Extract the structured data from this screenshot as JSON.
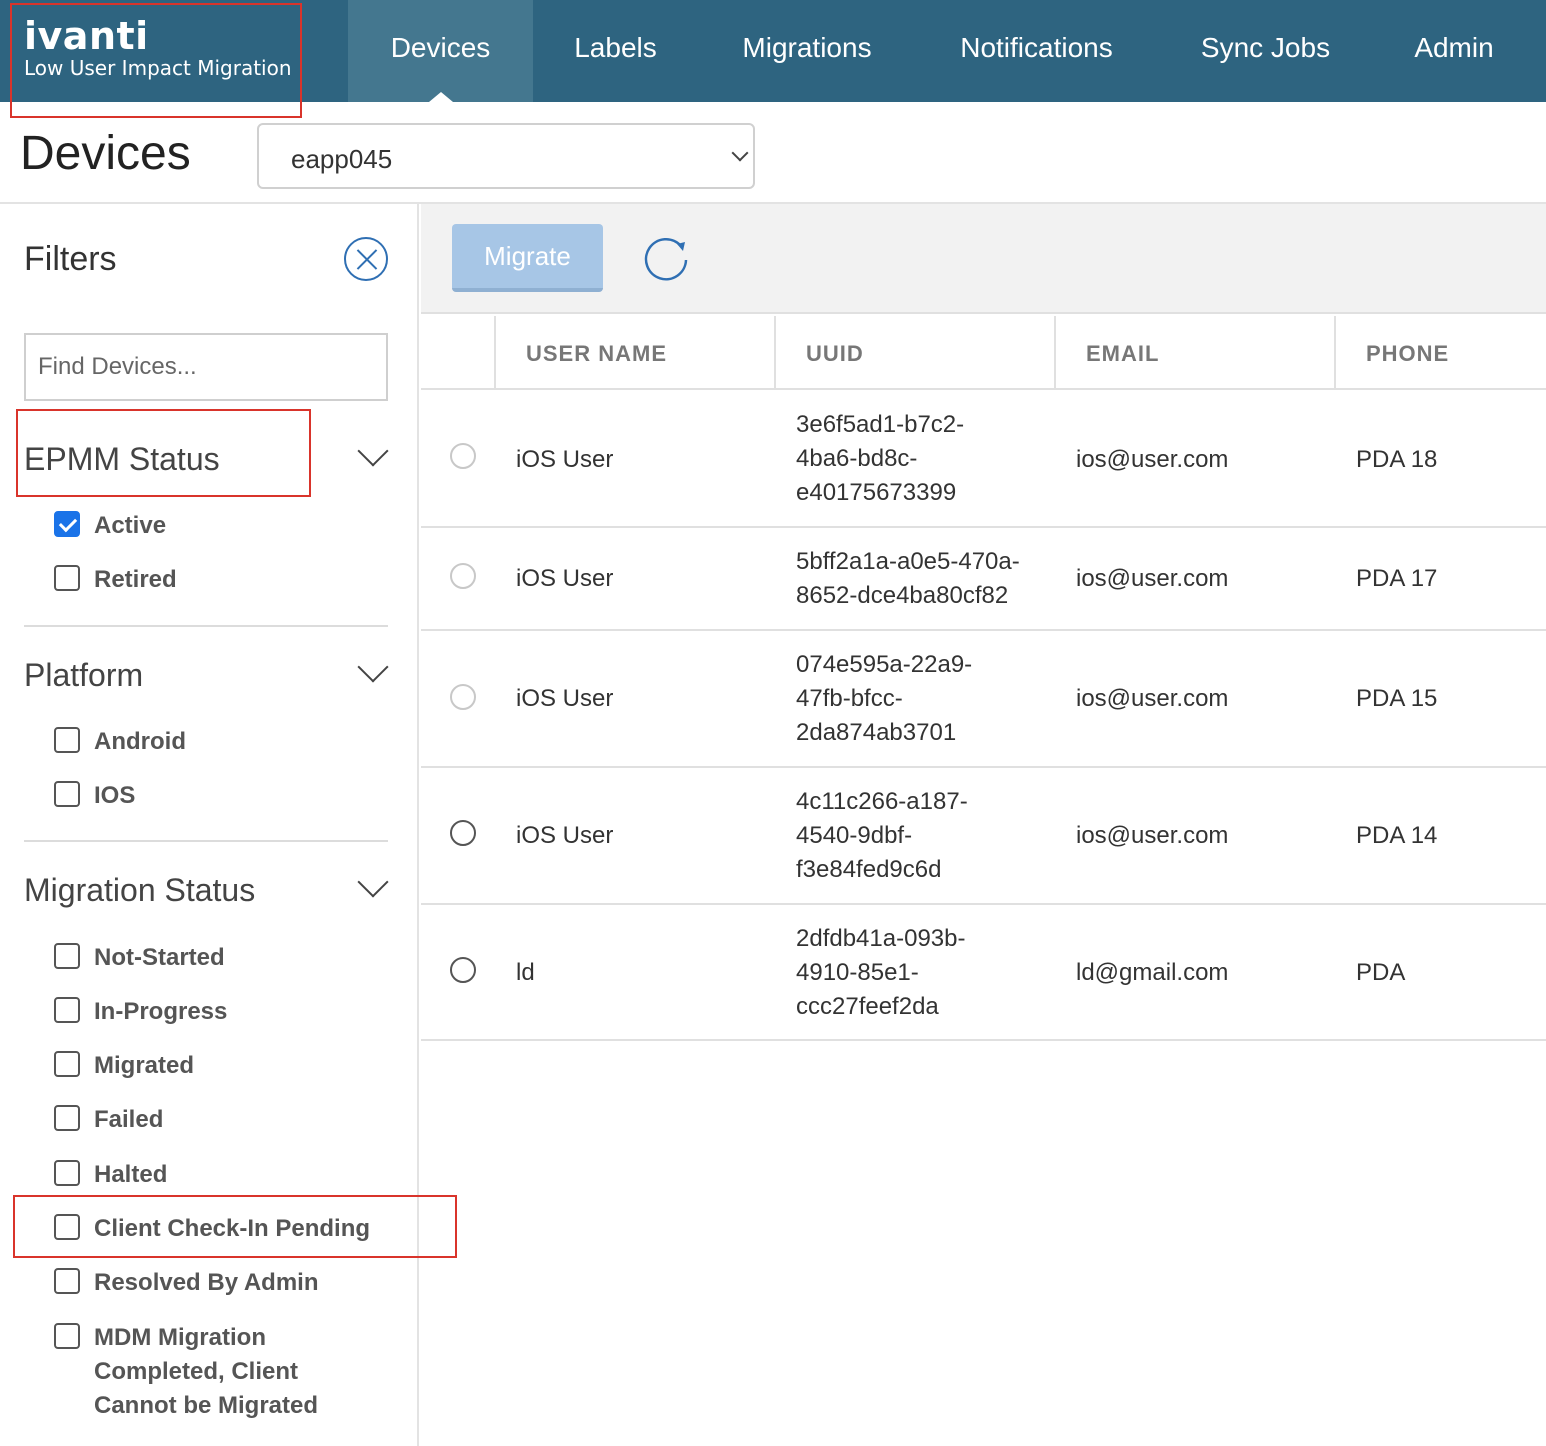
{
  "brand": {
    "logo": "ivanti",
    "subtitle": "Low User Impact Migration"
  },
  "nav": {
    "items": [
      {
        "label": "Devices",
        "active": true
      },
      {
        "label": "Labels",
        "active": false
      },
      {
        "label": "Migrations",
        "active": false
      },
      {
        "label": "Notifications",
        "active": false
      },
      {
        "label": "Sync Jobs",
        "active": false
      },
      {
        "label": "Admin",
        "active": false
      }
    ]
  },
  "page": {
    "title": "Devices",
    "tenant_select": "eapp045"
  },
  "filters": {
    "title": "Filters",
    "search_placeholder": "Find Devices...",
    "sections": [
      {
        "title": "EPMM Status",
        "options": [
          {
            "label": "Active",
            "checked": true
          },
          {
            "label": "Retired",
            "checked": false
          }
        ]
      },
      {
        "title": "Platform",
        "options": [
          {
            "label": "Android",
            "checked": false
          },
          {
            "label": "IOS",
            "checked": false
          }
        ]
      },
      {
        "title": "Migration Status",
        "options": [
          {
            "label": "Not-Started",
            "checked": false
          },
          {
            "label": "In-Progress",
            "checked": false
          },
          {
            "label": "Migrated",
            "checked": false
          },
          {
            "label": "Failed",
            "checked": false
          },
          {
            "label": "Halted",
            "checked": false
          },
          {
            "label": "Client Check-In Pending",
            "checked": false
          },
          {
            "label": "Resolved By Admin",
            "checked": false
          },
          {
            "label": "MDM Migration Completed, Client Cannot be Migrated",
            "checked": false
          }
        ]
      }
    ]
  },
  "toolbar": {
    "migrate_label": "Migrate"
  },
  "table": {
    "columns": [
      "USER NAME",
      "UUID",
      "EMAIL",
      "PHONE"
    ],
    "rows": [
      {
        "user": "iOS User",
        "uuid": [
          "3e6f5ad1-b7c2-",
          "4ba6-bd8c-",
          "e40175673399"
        ],
        "email": "ios@user.com",
        "phone": "PDA 18"
      },
      {
        "user": "iOS User",
        "uuid": [
          "5bff2a1a-a0e5-470a-",
          "8652-dce4ba80cf82"
        ],
        "email": "ios@user.com",
        "phone": "PDA 17"
      },
      {
        "user": "iOS User",
        "uuid": [
          "074e595a-22a9-",
          "47fb-bfcc-",
          "2da874ab3701"
        ],
        "email": "ios@user.com",
        "phone": "PDA 15"
      },
      {
        "user": "iOS User",
        "uuid": [
          "4c11c266-a187-",
          "4540-9dbf-",
          "f3e84fed9c6d"
        ],
        "email": "ios@user.com",
        "phone": "PDA 14"
      },
      {
        "user": "ld",
        "uuid": [
          "2dfdb41a-093b-",
          "4910-85e1-",
          "ccc27feef2da"
        ],
        "email": "ld@gmail.com",
        "phone": "PDA"
      }
    ]
  },
  "colors": {
    "nav_bg": "#2e6480",
    "nav_active": "#44778f",
    "accent_blue": "#1a73e8",
    "annotation_red": "#d9342b"
  }
}
